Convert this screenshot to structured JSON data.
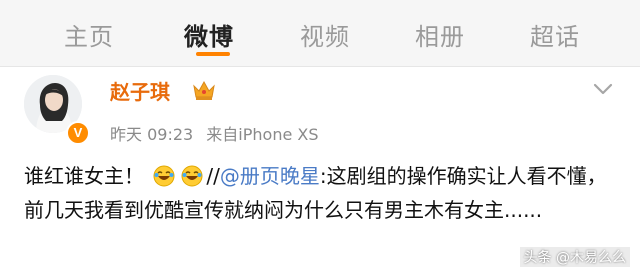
{
  "nav": {
    "tabs": [
      {
        "label": "主页",
        "active": false
      },
      {
        "label": "微博",
        "active": true
      },
      {
        "label": "视频",
        "active": false
      },
      {
        "label": "相册",
        "active": false
      },
      {
        "label": "超话",
        "active": false
      }
    ],
    "active_underline_color": "#ff8200"
  },
  "post": {
    "author": "赵子琪",
    "author_color": "#e86b0c",
    "timestamp": "昨天 09:23",
    "source": "来自iPhone XS",
    "verified_badge": "V",
    "body": {
      "part1": "谁红谁女主！",
      "part2": "//",
      "mention": "@册页晚星",
      "part3": ":这剧组的操作确实让人看不懂，前几天我看到优酷宣传就纳闷为什么只有男主木有女主......"
    },
    "emojis": [
      "laugh-cry-icon",
      "laugh-cry-icon"
    ],
    "mention_color": "#4a7bc6"
  },
  "watermark": "头条 @木易么么"
}
